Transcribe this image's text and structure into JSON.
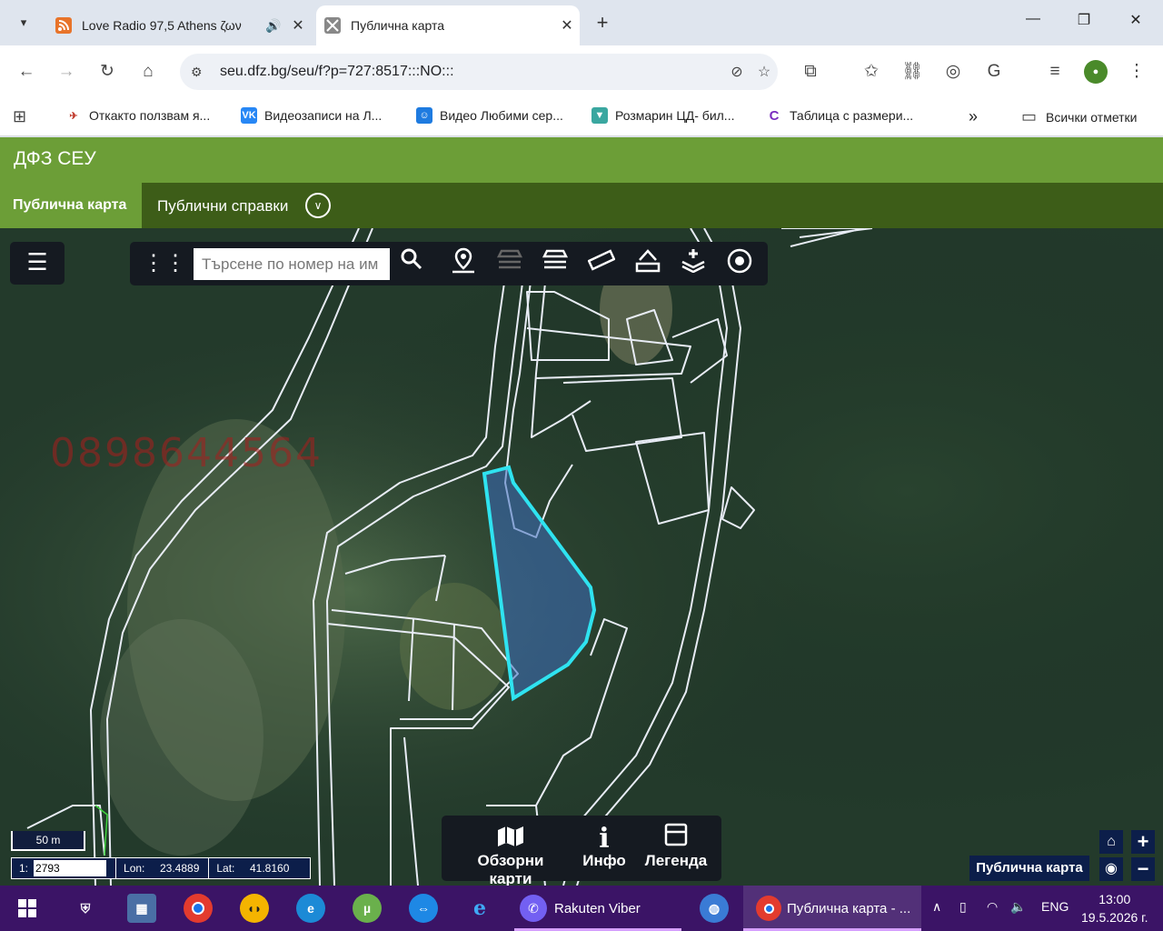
{
  "browser": {
    "tabs": [
      {
        "title": "Love Radio 97,5 Athens ζων",
        "icon": "rss-icon",
        "active": false
      },
      {
        "title": "Публична карта",
        "icon": "map-puzzle-icon",
        "active": true
      }
    ],
    "url": "seu.dfz.bg/seu/f?p=727:8517:::NO:::",
    "bookmarks": [
      {
        "label": "Откакто ползвам я...",
        "icon": "ghost-icon",
        "color": "#c0392b"
      },
      {
        "label": "Видеозаписи на Л...",
        "icon": "vk-icon",
        "color": "#2787f5"
      },
      {
        "label": "Видео Любими сер...",
        "icon": "smile-icon",
        "color": "#1e7be0"
      },
      {
        "label": "Розмарин ЦД- бил...",
        "icon": "shield-icon",
        "color": "#3aa7a0"
      },
      {
        "label": "Таблица с размери...",
        "icon": "c-logo-icon",
        "color": "#7a2dbf"
      }
    ],
    "bookmarks_more": "»",
    "all_bookmarks": "Всички отметки"
  },
  "app": {
    "title": "ДФЗ СЕУ",
    "nav": {
      "active": "Публична карта",
      "item": "Публични справки"
    }
  },
  "map": {
    "search_placeholder": "Търсене по номер на им",
    "watermark": "0898644564",
    "scale_label": "50 m",
    "scale_prefix": "1:",
    "scale_value": "2793",
    "lon_label": "Lon:",
    "lon_value": "23.4889",
    "lat_label": "Lat:",
    "lat_value": "41.8160",
    "bottom": {
      "overview": "Обзорни карти",
      "info": "Инфо",
      "legend": "Легенда"
    },
    "layer_label": "Публична карта",
    "highlight_color": "#2fe3f0"
  },
  "taskbar": {
    "apps": [
      {
        "label": "Rakuten Viber",
        "icon": "viber-icon"
      },
      {
        "label": "Публична карта - ...",
        "icon": "chrome-icon"
      }
    ],
    "language": "ENG",
    "time": "13:00",
    "date": "19.5.2026 г."
  }
}
